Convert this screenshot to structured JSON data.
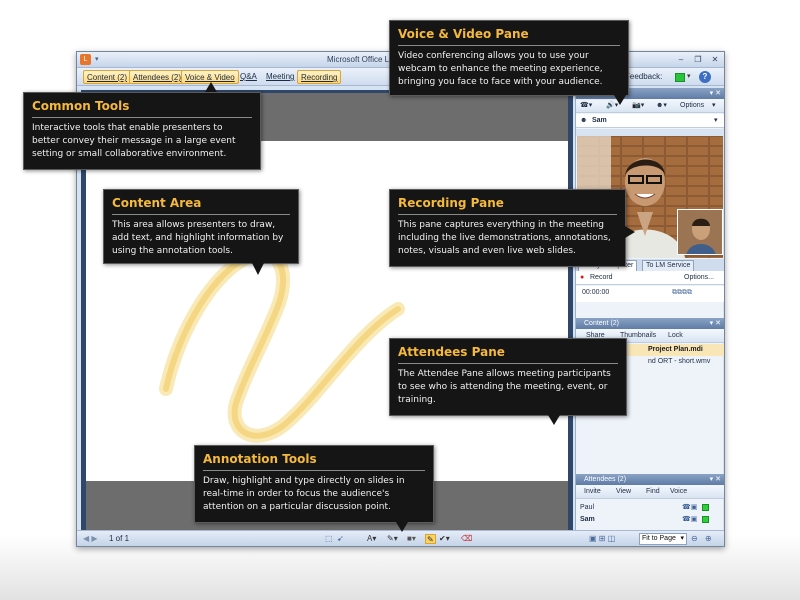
{
  "window": {
    "title": "Microsoft Office Liv",
    "app_logo": "L",
    "qat": "▾",
    "controls": [
      "‒",
      "❐",
      "✕"
    ]
  },
  "menubar": {
    "tabs": [
      {
        "label": "Content (2)",
        "highlighted": true
      },
      {
        "label": "Attendees (2)",
        "highlighted": true
      },
      {
        "label": "Voice & Video",
        "highlighted": true
      },
      {
        "label": "Q&A",
        "highlighted": false
      },
      {
        "label": "Meeting",
        "highlighted": false
      },
      {
        "label": "Recording",
        "highlighted": true
      }
    ],
    "feedback_label": "Feedback:",
    "feedback_arrow": "▾",
    "help": "?"
  },
  "voice_video_pane": {
    "toolbar_options": "Options",
    "toolbar_arrow": "▾",
    "speaker": "Sam",
    "dropdown": "▾"
  },
  "recording_pane": {
    "tabs": [
      "To My Computer",
      "To LM Service"
    ],
    "record_label": "Record",
    "options_label": "Options...",
    "timer": "00:00:00"
  },
  "content_pane": {
    "header": "Content (2)",
    "toolbar": [
      "Share",
      "Thumbnails",
      "Lock"
    ],
    "items": [
      "Project Plan.mdi",
      "nd ORT - short.wmv"
    ]
  },
  "attendees_pane": {
    "header": "Attendees (2)",
    "toolbar": [
      "Invite",
      "View",
      "Find",
      "Voice"
    ],
    "people": [
      {
        "name": "Paul",
        "bold": false
      },
      {
        "name": "Sam",
        "bold": true
      }
    ]
  },
  "bottombar": {
    "page_indicator": "1 of 1",
    "zoom_label": "Fit to Page",
    "zoom_arrow": "▾"
  },
  "callouts": [
    {
      "id": "voice",
      "title": "Voice & Video Pane",
      "text": "Video conferencing allows you to use your webcam to enhance the meeting experience, bringing you face to face with your audience."
    },
    {
      "id": "common",
      "title": "Common Tools",
      "text": "Interactive tools that enable presenters to better convey their message in a large event setting or small collaborative environment."
    },
    {
      "id": "content",
      "title": "Content Area",
      "text": "This area allows presenters to draw, add text, and highlight information by using the annotation tools."
    },
    {
      "id": "recording",
      "title": "Recording Pane",
      "text": "This pane captures everything in the meeting including the live demonstrations, annotations, notes, visuals and even live web slides."
    },
    {
      "id": "attendees",
      "title": "Attendees Pane",
      "text": "The Attendee Pane allows meeting participants to see who is attending the meeting, event, or training."
    },
    {
      "id": "annotation",
      "title": "Annotation Tools",
      "text": "Draw, highlight and type directly on slides in real-time in order to focus the audience's attention on a particular discussion point."
    }
  ],
  "colors": {
    "callout_bg": "#151515",
    "callout_title": "#f5b93b",
    "highlight_stroke": "#f4d37a",
    "status_green": "#2fcf3a",
    "window_frame": "#2f4769"
  }
}
